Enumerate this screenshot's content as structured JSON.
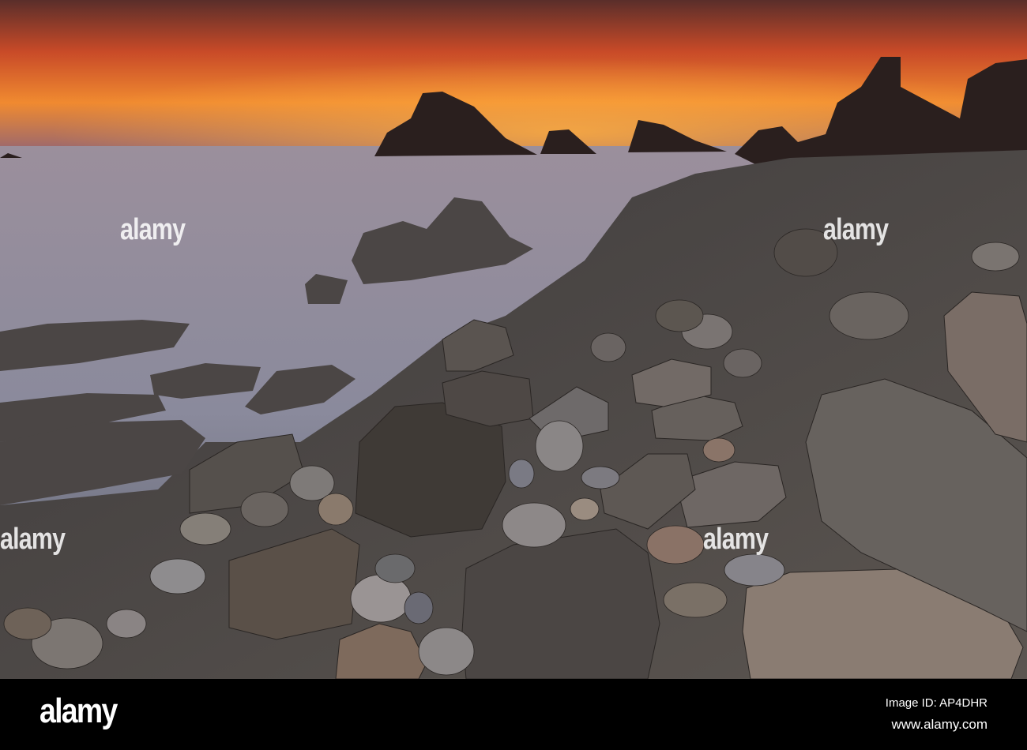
{
  "photo": {
    "subject": "rocky coastline at sunset",
    "colors": {
      "sky_top": "#3a2a3a",
      "sky_glow": "#f0802a",
      "sea": "#8c8a98",
      "rock": "#4a4540"
    }
  },
  "watermark": {
    "text": "alamy"
  },
  "footer": {
    "logo": "alamy",
    "image_id": "Image ID: AP4DHR",
    "website": "www.alamy.com"
  }
}
